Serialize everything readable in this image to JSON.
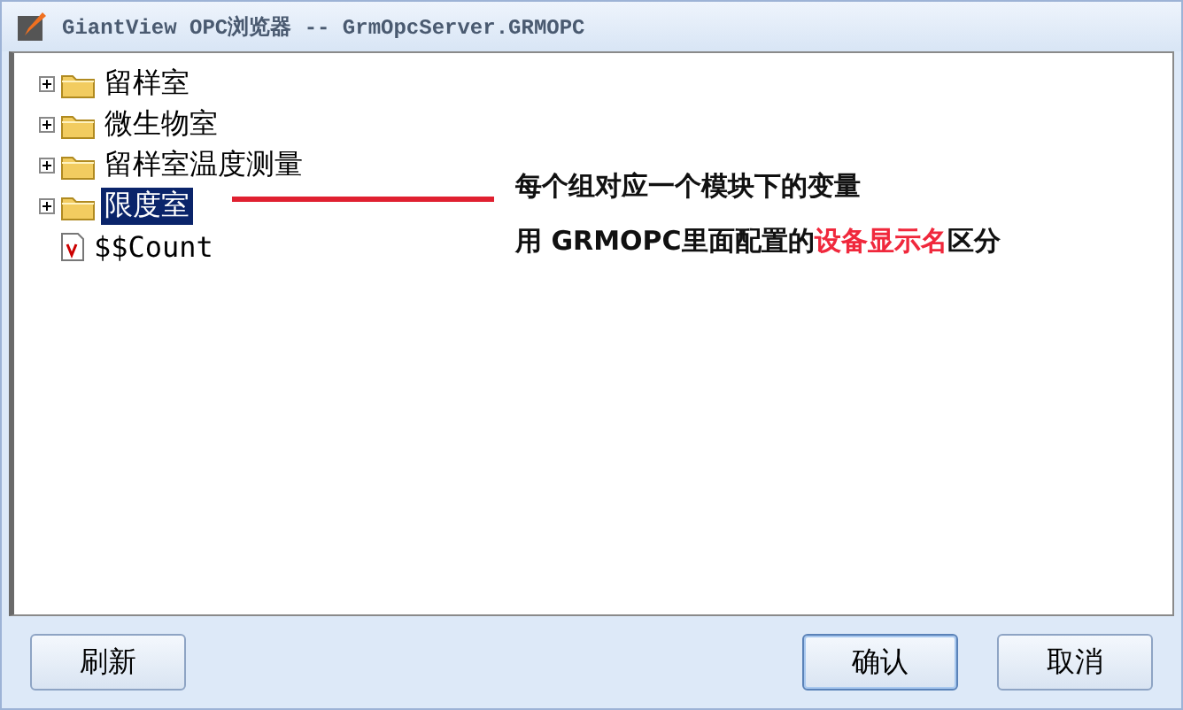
{
  "window": {
    "title": "GiantView OPC浏览器 -- GrmOpcServer.GRMOPC"
  },
  "tree": [
    {
      "kind": "folder",
      "label": "留样室",
      "expandable": true,
      "selected": false
    },
    {
      "kind": "folder",
      "label": "微生物室",
      "expandable": true,
      "selected": false
    },
    {
      "kind": "folder",
      "label": "留样室温度测量",
      "expandable": true,
      "selected": false
    },
    {
      "kind": "folder",
      "label": "限度室",
      "expandable": true,
      "selected": true
    },
    {
      "kind": "variable",
      "label": "$$Count",
      "expandable": false,
      "selected": false
    }
  ],
  "annotation": {
    "lines": [
      [
        {
          "text": "每个组对应一个模块下的变量",
          "highlight": false
        }
      ],
      [
        {
          "text": "用 GRMOPC里面配置的",
          "highlight": false
        },
        {
          "text": "设备显示名",
          "highlight": true
        },
        {
          "text": "区分",
          "highlight": false
        }
      ]
    ]
  },
  "buttons": [
    {
      "label": "刷新",
      "default": false
    },
    {
      "label": "确认",
      "default": true
    },
    {
      "label": "取消",
      "default": false
    }
  ]
}
